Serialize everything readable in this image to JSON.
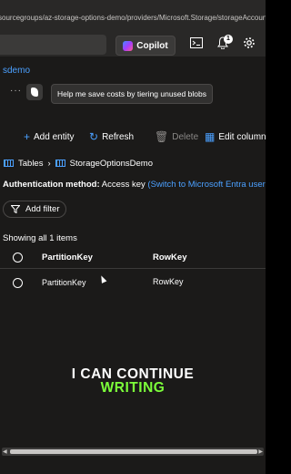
{
  "header": {
    "url_text": "sourcegroups/az-storage-options-demo/providers/Microsoft.Storage/storageAccounts/azs...",
    "copilot_label": "Copilot",
    "notification_count": "1"
  },
  "resource_name": "sdemo",
  "copilot_suggestion": "Help me save costs by tiering unused blobs",
  "toolbar": {
    "add_entity": "Add entity",
    "refresh": "Refresh",
    "delete": "Delete",
    "edit_columns": "Edit columns"
  },
  "breadcrumb": {
    "tables": "Tables",
    "table_name": "StorageOptionsDemo"
  },
  "auth": {
    "label": "Authentication method:",
    "value": "Access key",
    "link": "(Switch to Microsoft Entra user ac"
  },
  "filter_label": "Add filter",
  "showing_text": "Showing all 1 items",
  "columns": [
    "PartitionKey",
    "RowKey"
  ],
  "rows": [
    {
      "partition_key": "PartitionKey",
      "row_key": "RowKey"
    }
  ],
  "caption": {
    "line1": "I CAN CONTINUE",
    "line2": "WRITING"
  },
  "colors": {
    "accent": "#4ba0ff",
    "caption_highlight": "#7cff3a",
    "background": "#1b1a19"
  }
}
